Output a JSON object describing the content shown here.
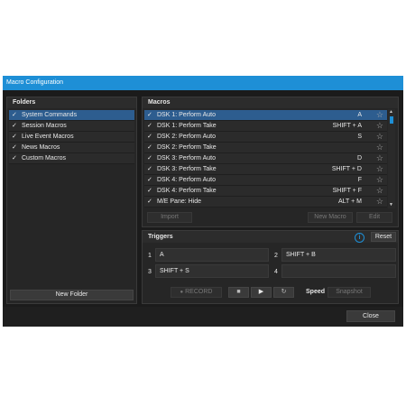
{
  "window": {
    "title": "Macro Configuration"
  },
  "folders": {
    "title": "Folders",
    "items": [
      {
        "label": "System Commands",
        "checked": true,
        "selected": true
      },
      {
        "label": "Session Macros",
        "checked": true,
        "selected": false
      },
      {
        "label": "Live Event Macros",
        "checked": true,
        "selected": false
      },
      {
        "label": "News Macros",
        "checked": true,
        "selected": false
      },
      {
        "label": "Custom Macros",
        "checked": true,
        "selected": false
      }
    ],
    "new_folder_label": "New Folder"
  },
  "macros": {
    "title": "Macros",
    "items": [
      {
        "label": "DSK 1: Perform Auto",
        "key": "A",
        "selected": true
      },
      {
        "label": "DSK 1: Perform Take",
        "key": "SHIFT + A",
        "selected": false
      },
      {
        "label": "DSK 2: Perform Auto",
        "key": "S",
        "selected": false
      },
      {
        "label": "DSK 2: Perform Take",
        "key": "",
        "selected": false
      },
      {
        "label": "DSK 3: Perform Auto",
        "key": "D",
        "selected": false
      },
      {
        "label": "DSK 3: Perform Take",
        "key": "SHIFT + D",
        "selected": false
      },
      {
        "label": "DSK 4: Perform Auto",
        "key": "F",
        "selected": false
      },
      {
        "label": "DSK 4: Perform Take",
        "key": "SHIFT + F",
        "selected": false
      },
      {
        "label": "M/E Pane: Hide",
        "key": "ALT + M",
        "selected": false
      }
    ],
    "import_label": "Import",
    "new_macro_label": "New Macro",
    "edit_label": "Edit"
  },
  "triggers": {
    "title": "Triggers",
    "info_icon": "info-icon",
    "reset_label": "Reset",
    "cells": [
      {
        "num": "1",
        "value": "A"
      },
      {
        "num": "2",
        "value": "SHIFT + B"
      },
      {
        "num": "3",
        "value": "SHIFT + S"
      },
      {
        "num": "4",
        "value": ""
      }
    ],
    "record_label": "RECORD",
    "speed_label": "Speed",
    "snapshot_label": "Snapshot"
  },
  "footer": {
    "close_label": "Close"
  },
  "colors": {
    "accent": "#1e8fd6",
    "selected_row": "#2d5d8f",
    "background": "#1b1b1b"
  }
}
